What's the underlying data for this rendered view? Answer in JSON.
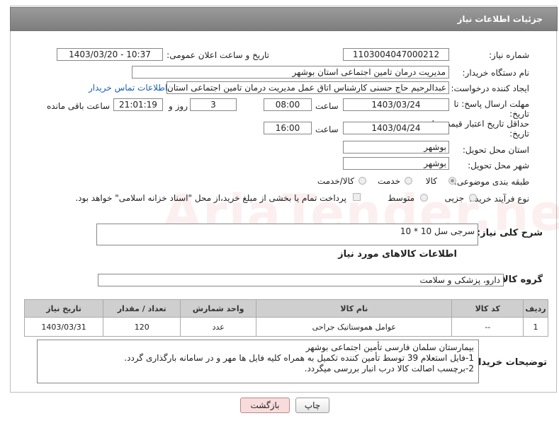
{
  "header": {
    "title": "جزئیات اطلاعات نیاز"
  },
  "fields": {
    "need_number_label": "شماره نیاز:",
    "need_number": "1103004047000212",
    "announce_label": "تاریخ و ساعت اعلان عمومی:",
    "announce_value": "1403/03/20 - 10:37",
    "buyer_org_label": "نام دستگاه خریدار:",
    "buyer_org": "مدیریت درمان تامین اجتماعی استان بوشهر",
    "creator_label": "ایجاد کننده درخواست:",
    "creator": "عبدالرحیم حاج حسنی کارشناس اتاق عمل مدیریت درمان تامین اجتماعی استان بوشهر",
    "contact_link": "اطلاعات تماس خریدار",
    "deadline_label_1": "مهلت ارسال پاسخ: تا",
    "deadline_label_2": "تاریخ:",
    "deadline_date": "1403/03/24",
    "time_label": "ساعت",
    "deadline_time": "08:00",
    "days_value": "3",
    "days_label": "روز و",
    "remaining_time": "21:01:19",
    "remaining_label": "ساعت باقی مانده",
    "validity_label_1": "حداقل تاریخ اعتبار قیمت: تا",
    "validity_label_2": "تاریخ:",
    "validity_date": "1403/04/24",
    "validity_time": "16:00",
    "province_label": "استان محل تحویل:",
    "province": "بوشهر",
    "city_label": "شهر محل تحویل:",
    "city": "بوشهر",
    "category_label": "طبقه بندی موضوعی:",
    "category_options": [
      "کالا",
      "خدمت",
      "کالا/خدمت"
    ],
    "category_selected": "کالا",
    "process_label": "نوع فرآیند خرید :",
    "process_options": [
      "جزیی",
      "متوسط"
    ],
    "process_note": "پرداخت تمام یا بخشی از مبلغ خرید،از محل \"اسناد خزانه اسلامی\" خواهد بود."
  },
  "summary": {
    "label": "شرح کلی نیاز:",
    "value": "سرجی سل 10 * 10"
  },
  "goods_section": {
    "title": "اطلاعات کالاهای مورد نیاز",
    "group_label": "گروه کالا:",
    "group_value": "دارو، پزشکی و سلامت"
  },
  "table": {
    "headers": [
      "ردیف",
      "کد کالا",
      "نام کالا",
      "واحد شمارش",
      "تعداد / مقدار",
      "تاریخ نیاز"
    ],
    "rows": [
      {
        "row": "1",
        "code": "--",
        "name": "عوامل هموستاتیک جراحی",
        "unit": "عدد",
        "qty": "120",
        "date": "1403/03/31"
      }
    ]
  },
  "buyer_notes": {
    "label": "توضیحات خریدار:",
    "lines": [
      "بیمارستان سلمان فارسی تأمین اجتماعی بوشهر",
      "1-فایل استعلام 39 توسط تأمین کننده تکمیل به همراه کلیه فایل ها مهر و در سامانه بارگذاری گردد.",
      "2-برچسب اصالت کالا درب انبار بررسی میگردد."
    ]
  },
  "buttons": {
    "print": "چاپ",
    "back": "بازگشت"
  },
  "watermark": "AriaTender.neT",
  "colors": {
    "header": "#8a8a8a",
    "link": "#1a5fb4",
    "back_button_bg": "#f8dcdc"
  }
}
